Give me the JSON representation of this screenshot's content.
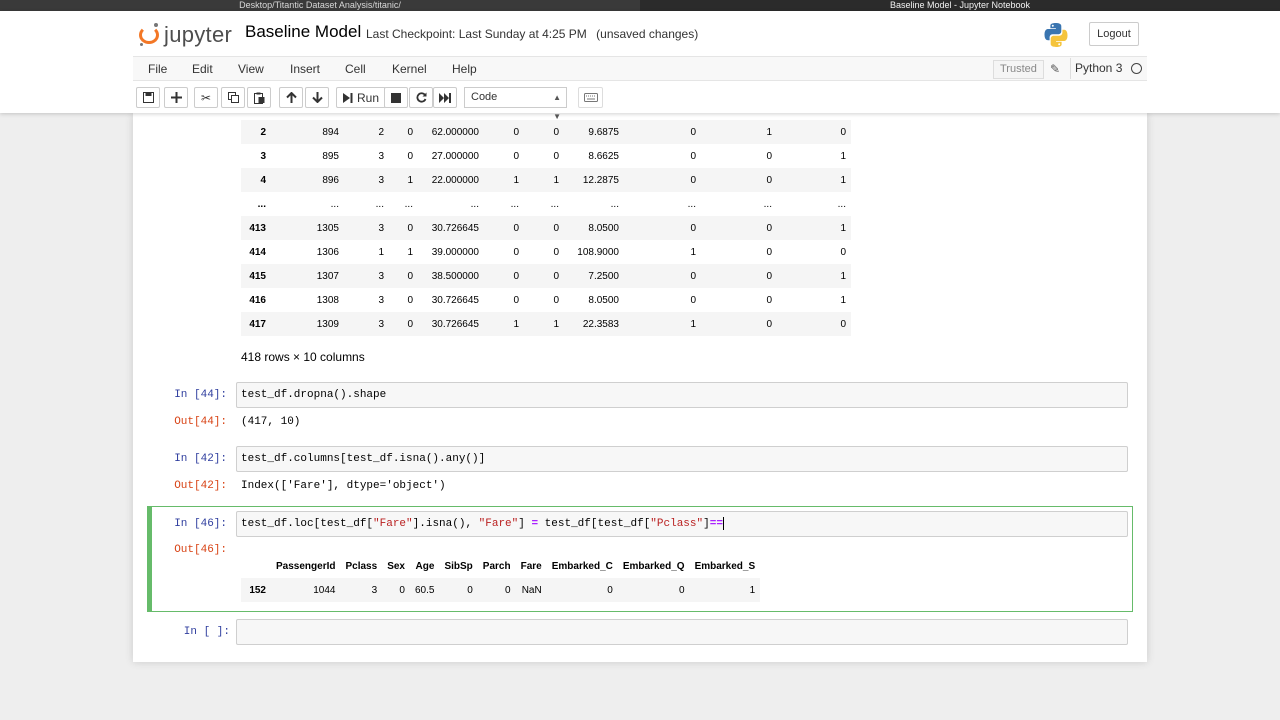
{
  "os": {
    "left_title": "Desktop/Titantic Dataset Analysis/titanic/",
    "right_title": "Baseline Model - Jupyter Notebook"
  },
  "header": {
    "logo_text": "jupyter",
    "notebook_title": "Baseline Model",
    "checkpoint": "Last Checkpoint: Last Sunday at 4:25 PM",
    "unsaved": "(unsaved changes)",
    "logout": "Logout"
  },
  "menu": {
    "items": [
      "File",
      "Edit",
      "View",
      "Insert",
      "Cell",
      "Kernel",
      "Help"
    ],
    "trusted": "Trusted",
    "kernel": "Python 3"
  },
  "toolbar": {
    "run_label": "Run",
    "cell_type": "Code"
  },
  "top_table": {
    "rows": [
      [
        "2",
        "894",
        "2",
        "0",
        "62.000000",
        "0",
        "0",
        "9.6875",
        "0",
        "1",
        "0"
      ],
      [
        "3",
        "895",
        "3",
        "0",
        "27.000000",
        "0",
        "0",
        "8.6625",
        "0",
        "0",
        "1"
      ],
      [
        "4",
        "896",
        "3",
        "1",
        "22.000000",
        "1",
        "1",
        "12.2875",
        "0",
        "0",
        "1"
      ],
      [
        "...",
        "...",
        "...",
        "...",
        "...",
        "...",
        "...",
        "...",
        "...",
        "...",
        "..."
      ],
      [
        "413",
        "1305",
        "3",
        "0",
        "30.726645",
        "0",
        "0",
        "8.0500",
        "0",
        "0",
        "1"
      ],
      [
        "414",
        "1306",
        "1",
        "1",
        "39.000000",
        "0",
        "0",
        "108.9000",
        "1",
        "0",
        "0"
      ],
      [
        "415",
        "1307",
        "3",
        "0",
        "38.500000",
        "0",
        "0",
        "7.2500",
        "0",
        "0",
        "1"
      ],
      [
        "416",
        "1308",
        "3",
        "0",
        "30.726645",
        "0",
        "0",
        "8.0500",
        "0",
        "0",
        "1"
      ],
      [
        "417",
        "1309",
        "3",
        "0",
        "30.726645",
        "1",
        "1",
        "22.3583",
        "1",
        "0",
        "0"
      ]
    ],
    "summary": "418 rows × 10 columns"
  },
  "cells": {
    "c44": {
      "in": "In [44]:",
      "code": "test_df.dropna().shape",
      "out": "Out[44]:",
      "result": "(417, 10)"
    },
    "c42": {
      "in": "In [42]:",
      "code": "test_df.columns[test_df.isna().any()]",
      "out": "Out[42]:",
      "result": "Index(['Fare'], dtype='object')"
    },
    "c46": {
      "in": "In [46]:",
      "code_parts": [
        "test_df.loc[test_df[",
        "\"Fare\"",
        "].isna(), ",
        "\"Fare\"",
        "] ",
        "=",
        " test_df[test_df[",
        "\"Pclass\"",
        "]",
        "=="
      ],
      "out": "Out[46]:"
    },
    "empty": {
      "in": "In [ ]:"
    }
  },
  "bottom_table": {
    "headers": [
      "",
      "PassengerId",
      "Pclass",
      "Sex",
      "Age",
      "SibSp",
      "Parch",
      "Fare",
      "Embarked_C",
      "Embarked_Q",
      "Embarked_S"
    ],
    "rows": [
      [
        "152",
        "1044",
        "3",
        "0",
        "60.5",
        "0",
        "0",
        "NaN",
        "0",
        "0",
        "1"
      ]
    ]
  }
}
